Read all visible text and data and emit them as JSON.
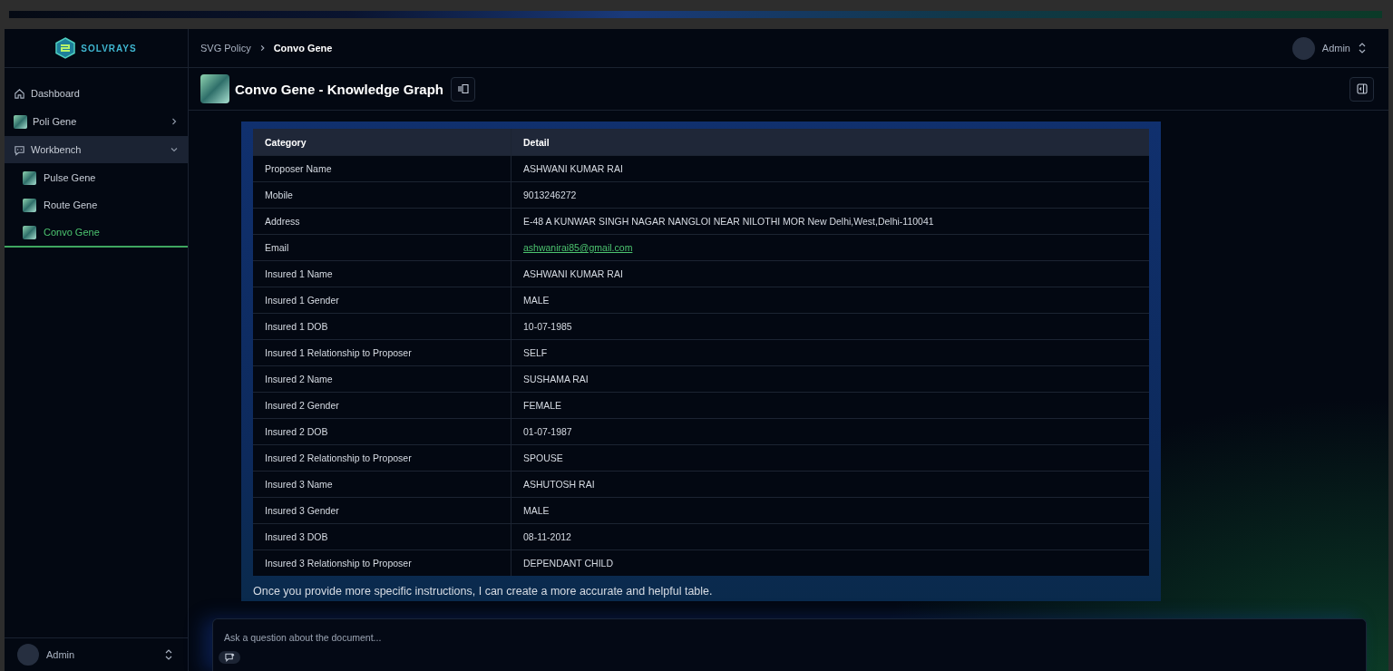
{
  "sidebar": {
    "logo": "SOLVRAYS",
    "items": [
      {
        "label": "Dashboard",
        "kind": "link",
        "expanded": false
      },
      {
        "label": "Poli Gene",
        "kind": "gene",
        "expanded": false
      },
      {
        "label": "Workbench",
        "kind": "section",
        "expanded": true,
        "children": [
          {
            "label": "Pulse Gene",
            "selected": false
          },
          {
            "label": "Route Gene",
            "selected": false
          },
          {
            "label": "Convo Gene",
            "selected": true
          }
        ]
      }
    ],
    "user": {
      "name": "Admin"
    }
  },
  "header": {
    "breadcrumb": [
      "SVG Policy",
      "Convo Gene"
    ],
    "user": {
      "name": "Admin"
    }
  },
  "page": {
    "title": "Convo Gene - Knowledge Graph"
  },
  "table": {
    "columns": [
      "Category",
      "Detail"
    ],
    "rows": [
      {
        "category": "Proposer Name",
        "detail": "ASHWANI KUMAR RAI",
        "kind": "text"
      },
      {
        "category": "Mobile",
        "detail": "9013246272",
        "kind": "text"
      },
      {
        "category": "Address",
        "detail": "E-48 A KUNWAR SINGH NAGAR NANGLOI NEAR NILOTHI MOR New Delhi,West,Delhi-110041",
        "kind": "text"
      },
      {
        "category": "Email",
        "detail": "ashwanirai85@gmail.com",
        "kind": "link"
      },
      {
        "category": "Insured 1 Name",
        "detail": "ASHWANI KUMAR RAI",
        "kind": "text"
      },
      {
        "category": "Insured 1 Gender",
        "detail": "MALE",
        "kind": "text"
      },
      {
        "category": "Insured 1 DOB",
        "detail": "10-07-1985",
        "kind": "text"
      },
      {
        "category": "Insured 1 Relationship to Proposer",
        "detail": "SELF",
        "kind": "text"
      },
      {
        "category": "Insured 2 Name",
        "detail": "SUSHAMA RAI",
        "kind": "text"
      },
      {
        "category": "Insured 2 Gender",
        "detail": "FEMALE",
        "kind": "text"
      },
      {
        "category": "Insured 2 DOB",
        "detail": "01-07-1987",
        "kind": "text"
      },
      {
        "category": "Insured 2 Relationship to Proposer",
        "detail": "SPOUSE",
        "kind": "text"
      },
      {
        "category": "Insured 3 Name",
        "detail": "ASHUTOSH RAI",
        "kind": "text"
      },
      {
        "category": "Insured 3 Gender",
        "detail": "MALE",
        "kind": "text"
      },
      {
        "category": "Insured 3 DOB",
        "detail": "08-11-2012",
        "kind": "text"
      },
      {
        "category": "Insured 3 Relationship to Proposer",
        "detail": "DEPENDANT CHILD",
        "kind": "text"
      }
    ]
  },
  "message": {
    "text": "Once you provide more specific instructions, I can create a more accurate and helpful table."
  },
  "composer": {
    "placeholder": "Ask a question about the document..."
  }
}
